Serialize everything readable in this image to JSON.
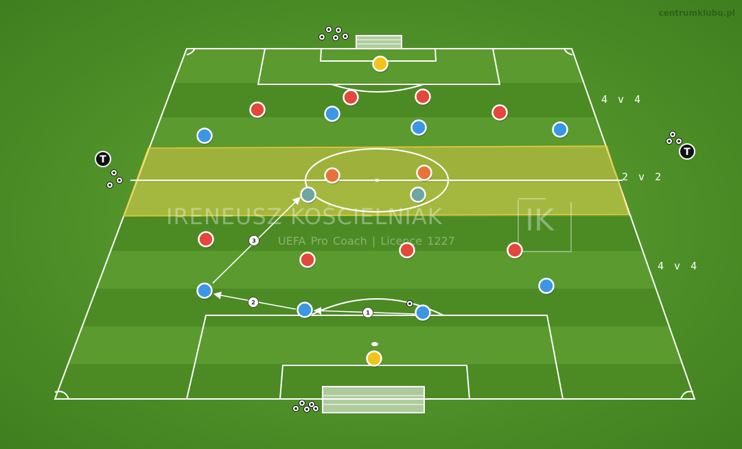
{
  "site": "centrumklubu.pl",
  "zones": {
    "top": "4 v 4",
    "middle": "2 v 2",
    "bottom": "4 v 4"
  },
  "watermark": {
    "name": "IRENEUSZ KOŚCIELNIAK",
    "subtitle": "UEFA Pro Coach  |  Licence 1227",
    "logo_text": "IK"
  },
  "colors": {
    "red_team": "#e4473c",
    "blue_team": "#3b97e3",
    "goalkeeper": "#f2c31b",
    "orange": "#e8733a",
    "teal": "#6ea6a0",
    "neutral_zone": "#e2d24f"
  },
  "coach_marker_letter": "T",
  "pass_labels": [
    "1",
    "2",
    "3"
  ]
}
